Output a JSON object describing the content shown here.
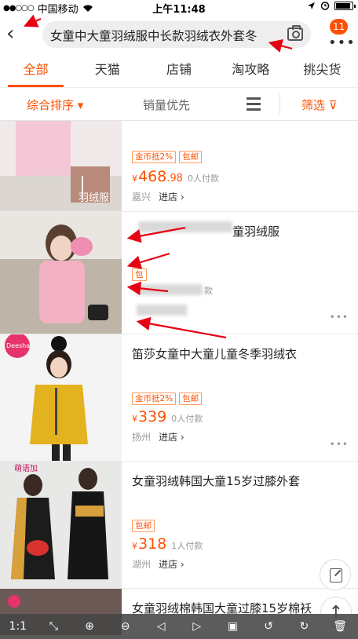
{
  "status_bar": {
    "carrier": "中国移动",
    "time": "上午11:48",
    "battery_level": 0.8
  },
  "search": {
    "query": "女童中大童羽绒服中长款羽绒衣外套冬",
    "back_icon": "chevron-left-icon",
    "camera_icon": "camera-icon",
    "message_badge": "11",
    "more_icon": "ellipsis-icon"
  },
  "tabs": [
    "全部",
    "天猫",
    "店铺",
    "淘攻略",
    "挑尖货"
  ],
  "sort": {
    "comprehensive": "综合排序 ▾",
    "sales": "销量优先",
    "filter": "筛选 ⊽"
  },
  "products": [
    {
      "title": "",
      "tags": [
        "金币抵2%",
        "包邮"
      ],
      "yen": "¥",
      "price_int": "468",
      "price_dec": ".98",
      "sold": "0人付款",
      "city": "嘉兴",
      "shop": "进店 ›",
      "thumb_text": "羽绒服"
    },
    {
      "title": "童羽绒服",
      "tags": [
        "包"
      ],
      "yen": "",
      "price_int": "",
      "price_dec": "",
      "sold": "款",
      "city": "",
      "shop": "",
      "thumb_text": ""
    },
    {
      "title": "笛莎女童中大童儿童冬季羽绒衣",
      "tags": [
        "金币抵2%",
        "包邮"
      ],
      "yen": "¥",
      "price_int": "339",
      "price_dec": "",
      "sold": "0人付款",
      "city": "扬州",
      "shop": "进店 ›",
      "thumb_text": "Deesha"
    },
    {
      "title": "女童羽绒韩国大童15岁过膝外套",
      "tags": [
        "包邮"
      ],
      "yen": "¥",
      "price_int": "318",
      "price_dec": "",
      "sold": "1人付款",
      "city": "湖州",
      "shop": "进店 ›",
      "thumb_text": "萌语加"
    },
    {
      "title": "女童羽绒棉韩国大童过膝15岁棉袄",
      "tags": [],
      "yen": "",
      "price_int": "",
      "price_dec": "",
      "sold": "",
      "city": "",
      "shop": "",
      "thumb_text": ""
    }
  ],
  "toolbar": {
    "zoom_label": "1:1"
  },
  "colors": {
    "accent": "#ff5000",
    "annotation": "#e60012"
  }
}
